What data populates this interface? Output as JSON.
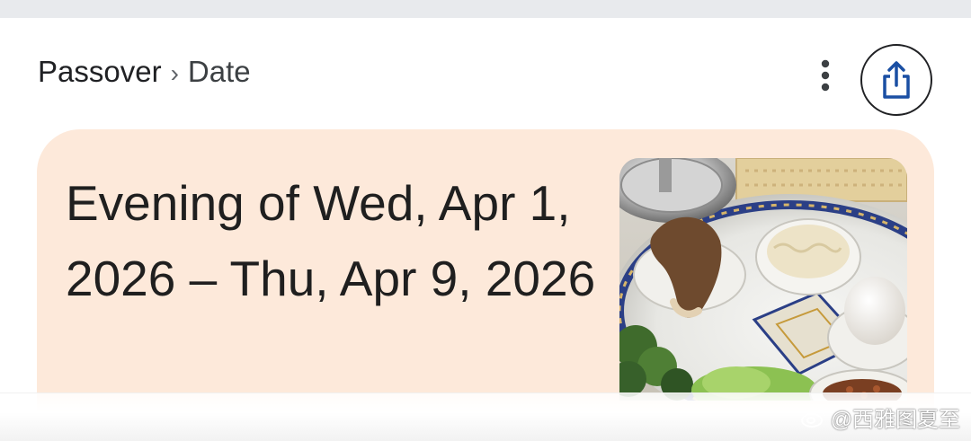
{
  "breadcrumb": {
    "parent": "Passover",
    "separator": "›",
    "current": "Date"
  },
  "actions": {
    "more_icon": "more-vert-icon",
    "share_icon": "share-icon",
    "accent": "#1a4fa3"
  },
  "card": {
    "headline": "Evening of Wed, Apr 1, 2026 – Thu, Apr 9, 2026",
    "background": "#fde9da"
  },
  "watermark": {
    "text": "@西雅图夏至"
  }
}
